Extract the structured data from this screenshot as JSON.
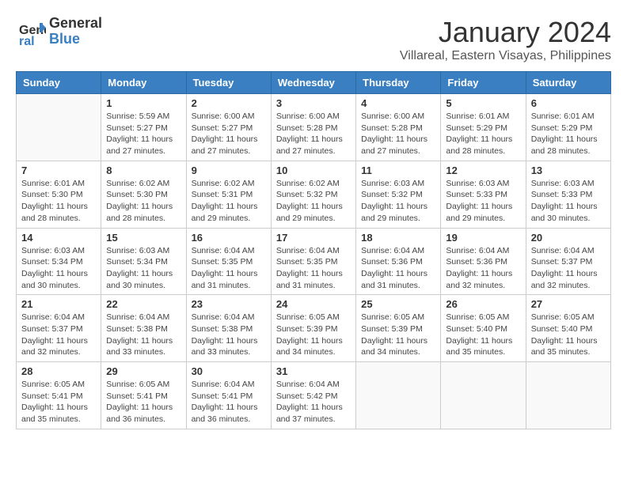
{
  "logo": {
    "line1": "General",
    "line2": "Blue"
  },
  "title": "January 2024",
  "location": "Villareal, Eastern Visayas, Philippines",
  "headers": [
    "Sunday",
    "Monday",
    "Tuesday",
    "Wednesday",
    "Thursday",
    "Friday",
    "Saturday"
  ],
  "weeks": [
    [
      {
        "day": "",
        "info": ""
      },
      {
        "day": "1",
        "info": "Sunrise: 5:59 AM\nSunset: 5:27 PM\nDaylight: 11 hours\nand 27 minutes."
      },
      {
        "day": "2",
        "info": "Sunrise: 6:00 AM\nSunset: 5:27 PM\nDaylight: 11 hours\nand 27 minutes."
      },
      {
        "day": "3",
        "info": "Sunrise: 6:00 AM\nSunset: 5:28 PM\nDaylight: 11 hours\nand 27 minutes."
      },
      {
        "day": "4",
        "info": "Sunrise: 6:00 AM\nSunset: 5:28 PM\nDaylight: 11 hours\nand 27 minutes."
      },
      {
        "day": "5",
        "info": "Sunrise: 6:01 AM\nSunset: 5:29 PM\nDaylight: 11 hours\nand 28 minutes."
      },
      {
        "day": "6",
        "info": "Sunrise: 6:01 AM\nSunset: 5:29 PM\nDaylight: 11 hours\nand 28 minutes."
      }
    ],
    [
      {
        "day": "7",
        "info": "Sunrise: 6:01 AM\nSunset: 5:30 PM\nDaylight: 11 hours\nand 28 minutes."
      },
      {
        "day": "8",
        "info": "Sunrise: 6:02 AM\nSunset: 5:30 PM\nDaylight: 11 hours\nand 28 minutes."
      },
      {
        "day": "9",
        "info": "Sunrise: 6:02 AM\nSunset: 5:31 PM\nDaylight: 11 hours\nand 29 minutes."
      },
      {
        "day": "10",
        "info": "Sunrise: 6:02 AM\nSunset: 5:32 PM\nDaylight: 11 hours\nand 29 minutes."
      },
      {
        "day": "11",
        "info": "Sunrise: 6:03 AM\nSunset: 5:32 PM\nDaylight: 11 hours\nand 29 minutes."
      },
      {
        "day": "12",
        "info": "Sunrise: 6:03 AM\nSunset: 5:33 PM\nDaylight: 11 hours\nand 29 minutes."
      },
      {
        "day": "13",
        "info": "Sunrise: 6:03 AM\nSunset: 5:33 PM\nDaylight: 11 hours\nand 30 minutes."
      }
    ],
    [
      {
        "day": "14",
        "info": "Sunrise: 6:03 AM\nSunset: 5:34 PM\nDaylight: 11 hours\nand 30 minutes."
      },
      {
        "day": "15",
        "info": "Sunrise: 6:03 AM\nSunset: 5:34 PM\nDaylight: 11 hours\nand 30 minutes."
      },
      {
        "day": "16",
        "info": "Sunrise: 6:04 AM\nSunset: 5:35 PM\nDaylight: 11 hours\nand 31 minutes."
      },
      {
        "day": "17",
        "info": "Sunrise: 6:04 AM\nSunset: 5:35 PM\nDaylight: 11 hours\nand 31 minutes."
      },
      {
        "day": "18",
        "info": "Sunrise: 6:04 AM\nSunset: 5:36 PM\nDaylight: 11 hours\nand 31 minutes."
      },
      {
        "day": "19",
        "info": "Sunrise: 6:04 AM\nSunset: 5:36 PM\nDaylight: 11 hours\nand 32 minutes."
      },
      {
        "day": "20",
        "info": "Sunrise: 6:04 AM\nSunset: 5:37 PM\nDaylight: 11 hours\nand 32 minutes."
      }
    ],
    [
      {
        "day": "21",
        "info": "Sunrise: 6:04 AM\nSunset: 5:37 PM\nDaylight: 11 hours\nand 32 minutes."
      },
      {
        "day": "22",
        "info": "Sunrise: 6:04 AM\nSunset: 5:38 PM\nDaylight: 11 hours\nand 33 minutes."
      },
      {
        "day": "23",
        "info": "Sunrise: 6:04 AM\nSunset: 5:38 PM\nDaylight: 11 hours\nand 33 minutes."
      },
      {
        "day": "24",
        "info": "Sunrise: 6:05 AM\nSunset: 5:39 PM\nDaylight: 11 hours\nand 34 minutes."
      },
      {
        "day": "25",
        "info": "Sunrise: 6:05 AM\nSunset: 5:39 PM\nDaylight: 11 hours\nand 34 minutes."
      },
      {
        "day": "26",
        "info": "Sunrise: 6:05 AM\nSunset: 5:40 PM\nDaylight: 11 hours\nand 35 minutes."
      },
      {
        "day": "27",
        "info": "Sunrise: 6:05 AM\nSunset: 5:40 PM\nDaylight: 11 hours\nand 35 minutes."
      }
    ],
    [
      {
        "day": "28",
        "info": "Sunrise: 6:05 AM\nSunset: 5:41 PM\nDaylight: 11 hours\nand 35 minutes."
      },
      {
        "day": "29",
        "info": "Sunrise: 6:05 AM\nSunset: 5:41 PM\nDaylight: 11 hours\nand 36 minutes."
      },
      {
        "day": "30",
        "info": "Sunrise: 6:04 AM\nSunset: 5:41 PM\nDaylight: 11 hours\nand 36 minutes."
      },
      {
        "day": "31",
        "info": "Sunrise: 6:04 AM\nSunset: 5:42 PM\nDaylight: 11 hours\nand 37 minutes."
      },
      {
        "day": "",
        "info": ""
      },
      {
        "day": "",
        "info": ""
      },
      {
        "day": "",
        "info": ""
      }
    ]
  ]
}
